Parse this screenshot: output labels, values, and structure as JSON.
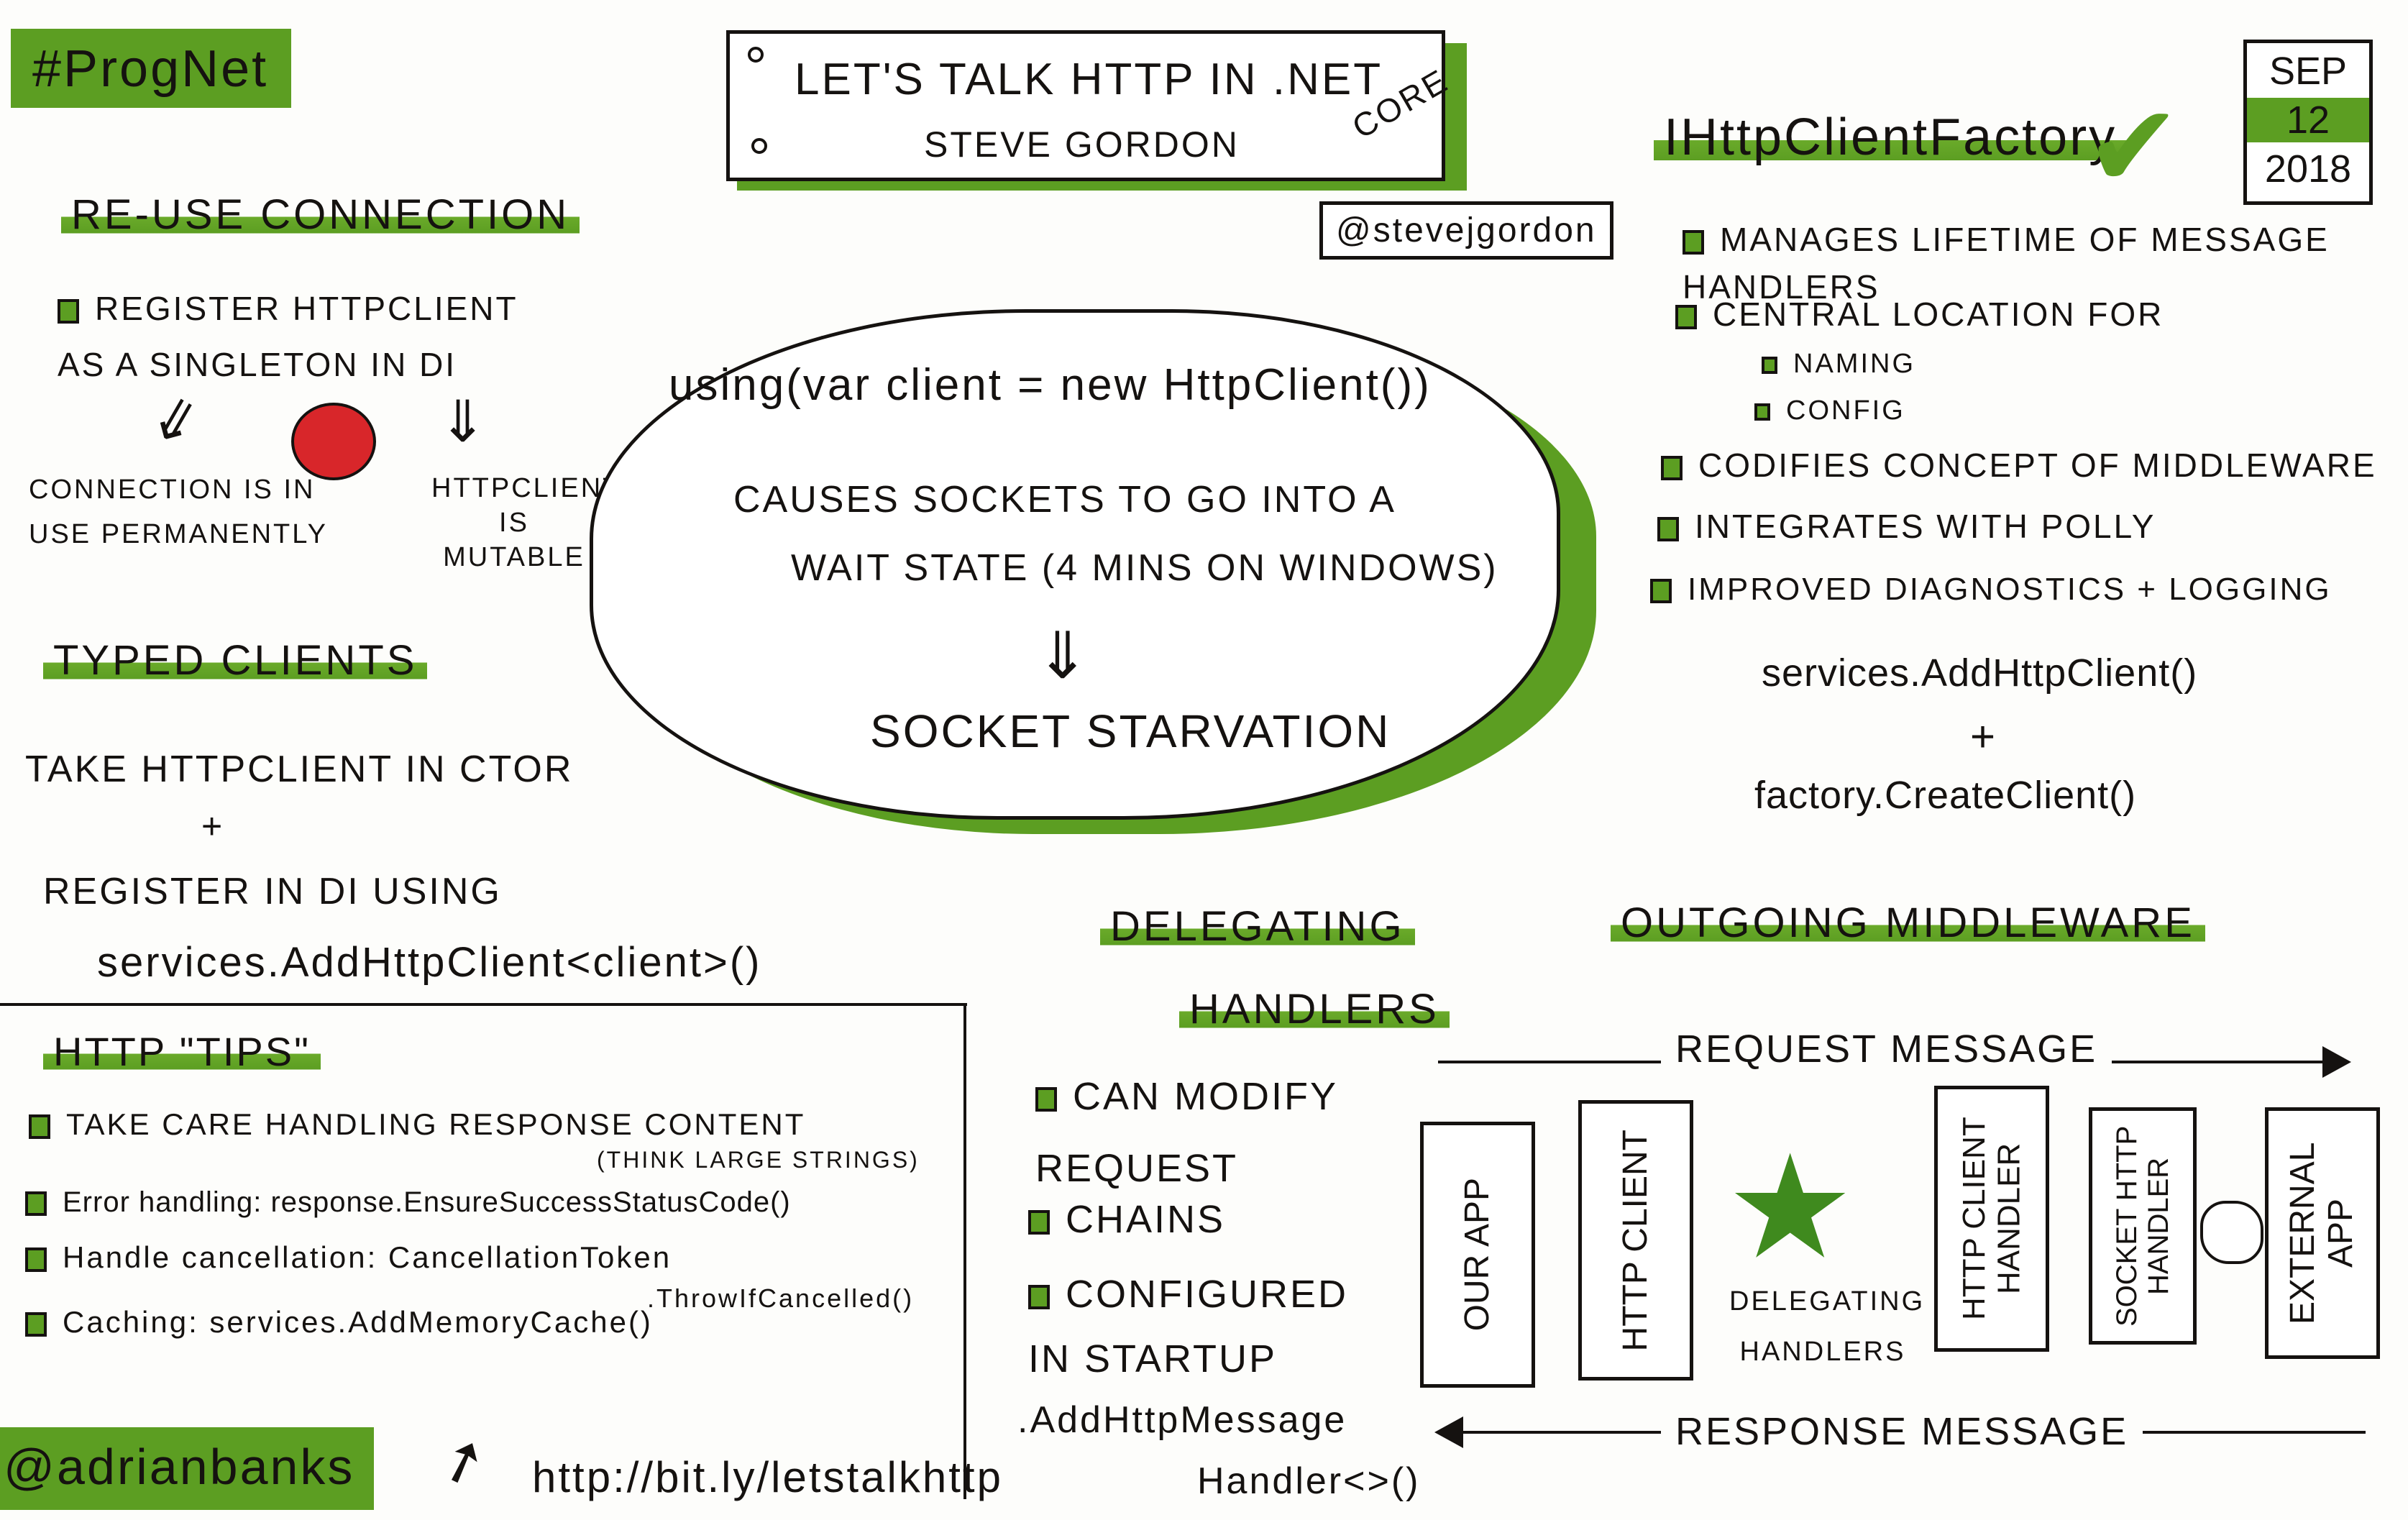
{
  "hashtag": "#ProgNet",
  "title": {
    "line1": "Let's talk HTTP in .NET",
    "core": "Core",
    "speaker": "Steve Gordon",
    "handle": "@stevejgordon"
  },
  "date": {
    "month": "SEP",
    "day": "12",
    "year": "2018"
  },
  "reuse": {
    "heading": "Re-use connection",
    "bullet": "Register HttpClient as a singleton in DI",
    "left_consequence": "Connection is in use permanently",
    "right_consequence": "HttpClient is mutable",
    "arrow": "⇓"
  },
  "cloud": {
    "code": "using(var client = new HttpClient())",
    "line1": "Causes sockets to go into a",
    "line2": "wait state (4 mins on Windows)",
    "arrow": "⇓",
    "result": "Socket starvation"
  },
  "factory": {
    "heading": "IHttpClientFactory",
    "check": "✔",
    "items": [
      {
        "text": "Manages lifetime of message handlers"
      },
      {
        "text": "Central location for",
        "sub": [
          "Naming",
          "Config"
        ]
      },
      {
        "text": "Codifies concept of middleware"
      },
      {
        "text": "Integrates with Polly"
      },
      {
        "text": "Improved diagnostics + logging"
      }
    ],
    "code1": "services.AddHttpClient()",
    "plus": "+",
    "code2": "factory.CreateClient()"
  },
  "typed": {
    "heading": "Typed clients",
    "line1": "Take HttpClient in ctor",
    "plus": "+",
    "line2": "Register in DI using",
    "code": "services.AddHttpClient<client>()"
  },
  "tips": {
    "heading": "HTTP \"tips\"",
    "items": [
      {
        "text": "Take care handling response content",
        "note": "(think large strings)"
      },
      {
        "text": "Error handling: response.EnsureSuccessStatusCode()"
      },
      {
        "text": "Handle cancellation: CancellationToken",
        "note": ".ThrowIfCancelled()"
      },
      {
        "text": "Caching: services.AddMemoryCache()"
      }
    ]
  },
  "author": "@adrianbanks",
  "link": "http://bit.ly/letstalkhttp",
  "delegating": {
    "heading1": "Delegating",
    "heading2": "handlers",
    "items": [
      "Can modify request",
      "Chains",
      "Configured in startup"
    ],
    "code1": ".AddHttpMessage",
    "code2": "Handler<>()"
  },
  "middleware": {
    "heading": "Outgoing middleware",
    "request": "Request message",
    "response": "Response message",
    "stages": [
      "Our app",
      "Http client",
      "Delegating handlers",
      "Http client handler",
      "Socket Http handler",
      "External app"
    ]
  },
  "colors": {
    "accent": "#5c9e22",
    "ink": "#151210",
    "stop": "#d8262a"
  }
}
